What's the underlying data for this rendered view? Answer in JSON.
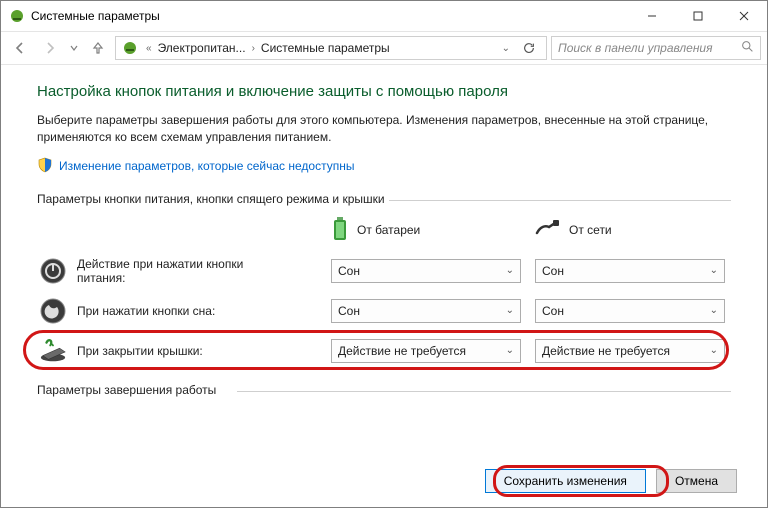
{
  "window": {
    "title": "Системные параметры"
  },
  "nav": {
    "crumb1": "Электропитан...",
    "crumb2": "Системные параметры",
    "searchPlaceholder": "Поиск в панели управления"
  },
  "content": {
    "heading": "Настройка кнопок питания и включение защиты с помощью пароля",
    "desc": "Выберите параметры завершения работы для этого компьютера. Изменения параметров, внесенные на этой странице, применяются ко всем схемам управления питанием.",
    "unlockLink": "Изменение параметров, которые сейчас недоступны",
    "section1": "Параметры кнопки питания, кнопки спящего режима и крышки",
    "col_battery": "От батареи",
    "col_ac": "От сети",
    "rows": {
      "power": {
        "label": "Действие при нажатии кнопки питания:",
        "battery": "Сон",
        "ac": "Сон"
      },
      "sleep": {
        "label": "При нажатии кнопки сна:",
        "battery": "Сон",
        "ac": "Сон"
      },
      "lid": {
        "label": "При закрытии крышки:",
        "battery": "Действие не требуется",
        "ac": "Действие не требуется"
      }
    },
    "section2": "Параметры завершения работы"
  },
  "footer": {
    "save": "Сохранить изменения",
    "cancel": "Отмена"
  }
}
